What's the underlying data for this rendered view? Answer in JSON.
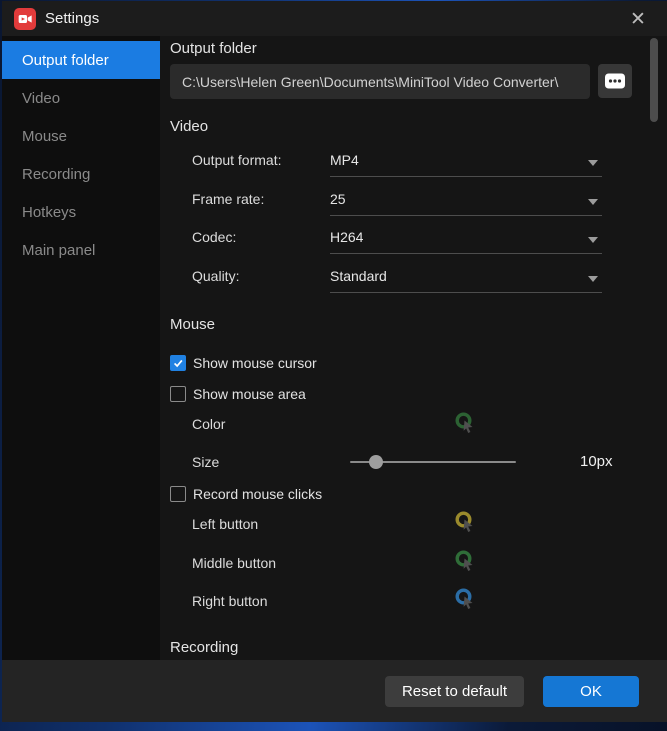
{
  "window": {
    "title": "Settings",
    "close_glyph": "✕"
  },
  "sidebar": {
    "items": [
      {
        "label": "Output folder",
        "selected": true
      },
      {
        "label": "Video",
        "selected": false
      },
      {
        "label": "Mouse",
        "selected": false
      },
      {
        "label": "Recording",
        "selected": false
      },
      {
        "label": "Hotkeys",
        "selected": false
      },
      {
        "label": "Main panel",
        "selected": false
      }
    ]
  },
  "content": {
    "output_folder": {
      "header": "Output folder",
      "path": "C:\\Users\\Helen Green\\Documents\\MiniTool Video Converter\\"
    },
    "video": {
      "header": "Video",
      "rows": [
        {
          "label": "Output format:",
          "value": "MP4"
        },
        {
          "label": "Frame rate:",
          "value": "25"
        },
        {
          "label": "Codec:",
          "value": "H264"
        },
        {
          "label": "Quality:",
          "value": "Standard"
        }
      ]
    },
    "mouse": {
      "header": "Mouse",
      "show_cursor": {
        "label": "Show mouse cursor",
        "checked": true
      },
      "show_area": {
        "label": "Show mouse area",
        "checked": false
      },
      "color_row": {
        "label": "Color",
        "ring_color": "#2c6233"
      },
      "size_row": {
        "label": "Size",
        "value": "10px"
      },
      "record_clicks": {
        "label": "Record mouse clicks",
        "checked": false
      },
      "click_buttons": [
        {
          "label": "Left button",
          "ring_color": "#9a8a2c"
        },
        {
          "label": "Middle button",
          "ring_color": "#2f6d38"
        },
        {
          "label": "Right button",
          "ring_color": "#2b6da5"
        }
      ]
    },
    "recording": {
      "header": "Recording"
    }
  },
  "footer": {
    "reset_label": "Reset to default",
    "ok_label": "OK"
  },
  "colors": {
    "accent_blue": "#1b7ce2",
    "ok_button_blue": "#1577d4",
    "checkbox_checked": "#2081e2",
    "app_icon_red": "#e23b3b"
  }
}
